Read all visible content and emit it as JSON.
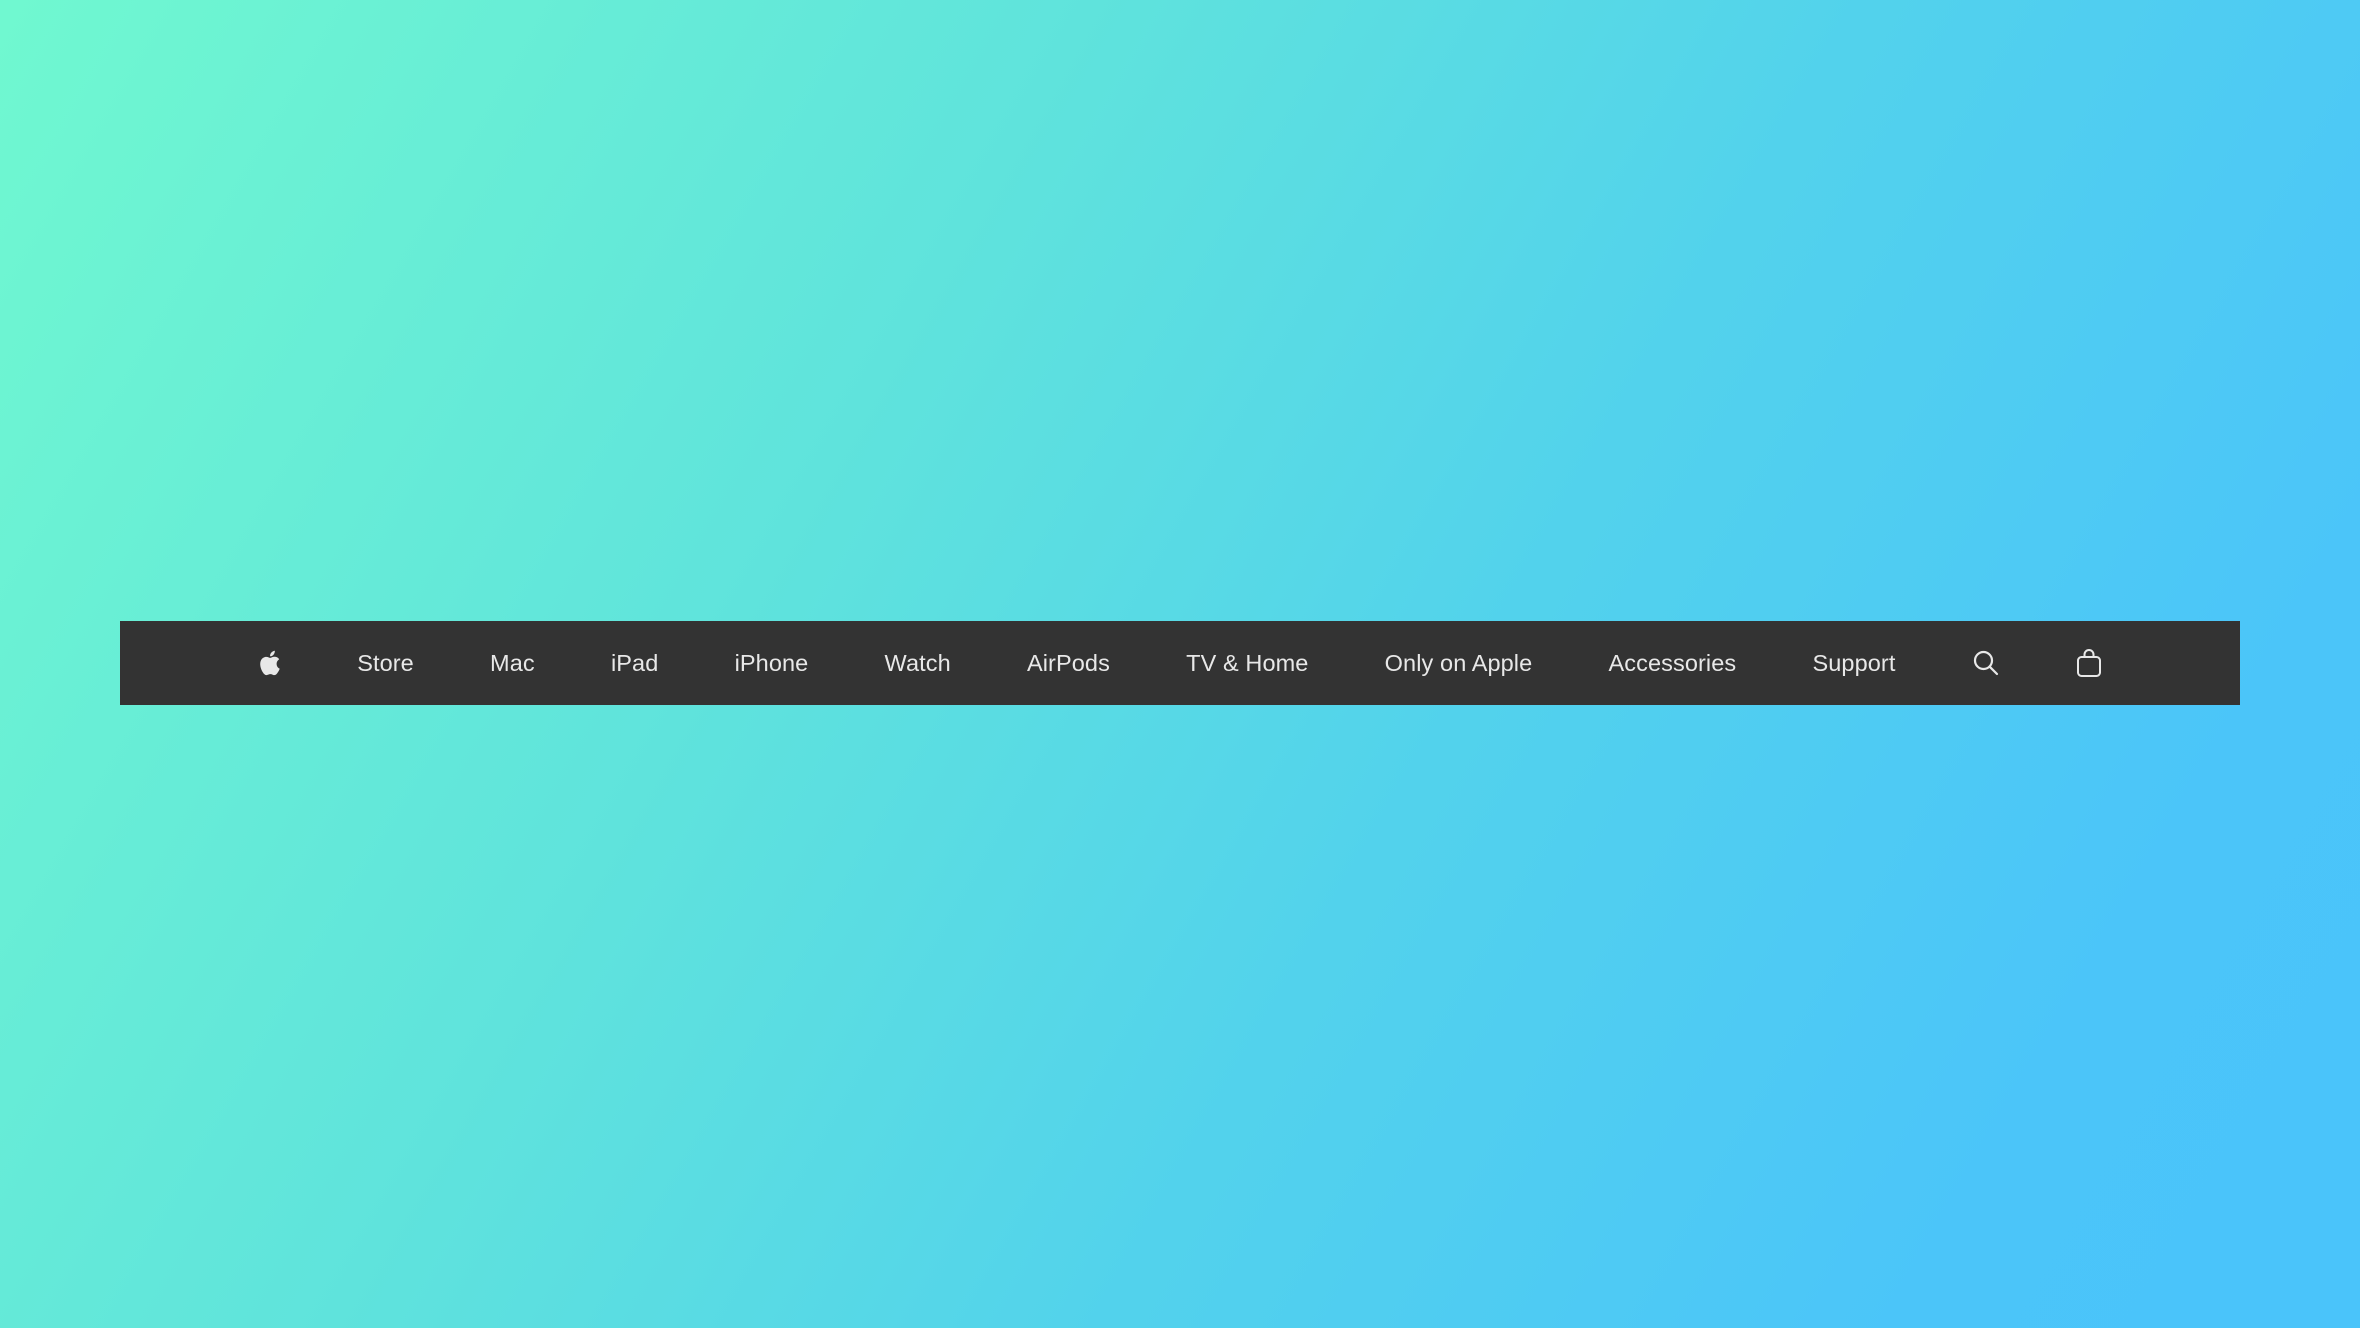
{
  "page": {
    "background_gradient": [
      "#70f8d0",
      "#4ac4fa"
    ]
  },
  "globalnav": {
    "background_color": "#333333",
    "text_color": "#e8e8e8",
    "logo_icon": "apple-logo-icon",
    "items": [
      {
        "label": "Store"
      },
      {
        "label": "Mac"
      },
      {
        "label": "iPad"
      },
      {
        "label": "iPhone"
      },
      {
        "label": "Watch"
      },
      {
        "label": "AirPods"
      },
      {
        "label": "TV & Home"
      },
      {
        "label": "Only on Apple"
      },
      {
        "label": "Accessories"
      },
      {
        "label": "Support"
      }
    ],
    "search_icon": "search-icon",
    "bag_icon": "shopping-bag-icon"
  }
}
